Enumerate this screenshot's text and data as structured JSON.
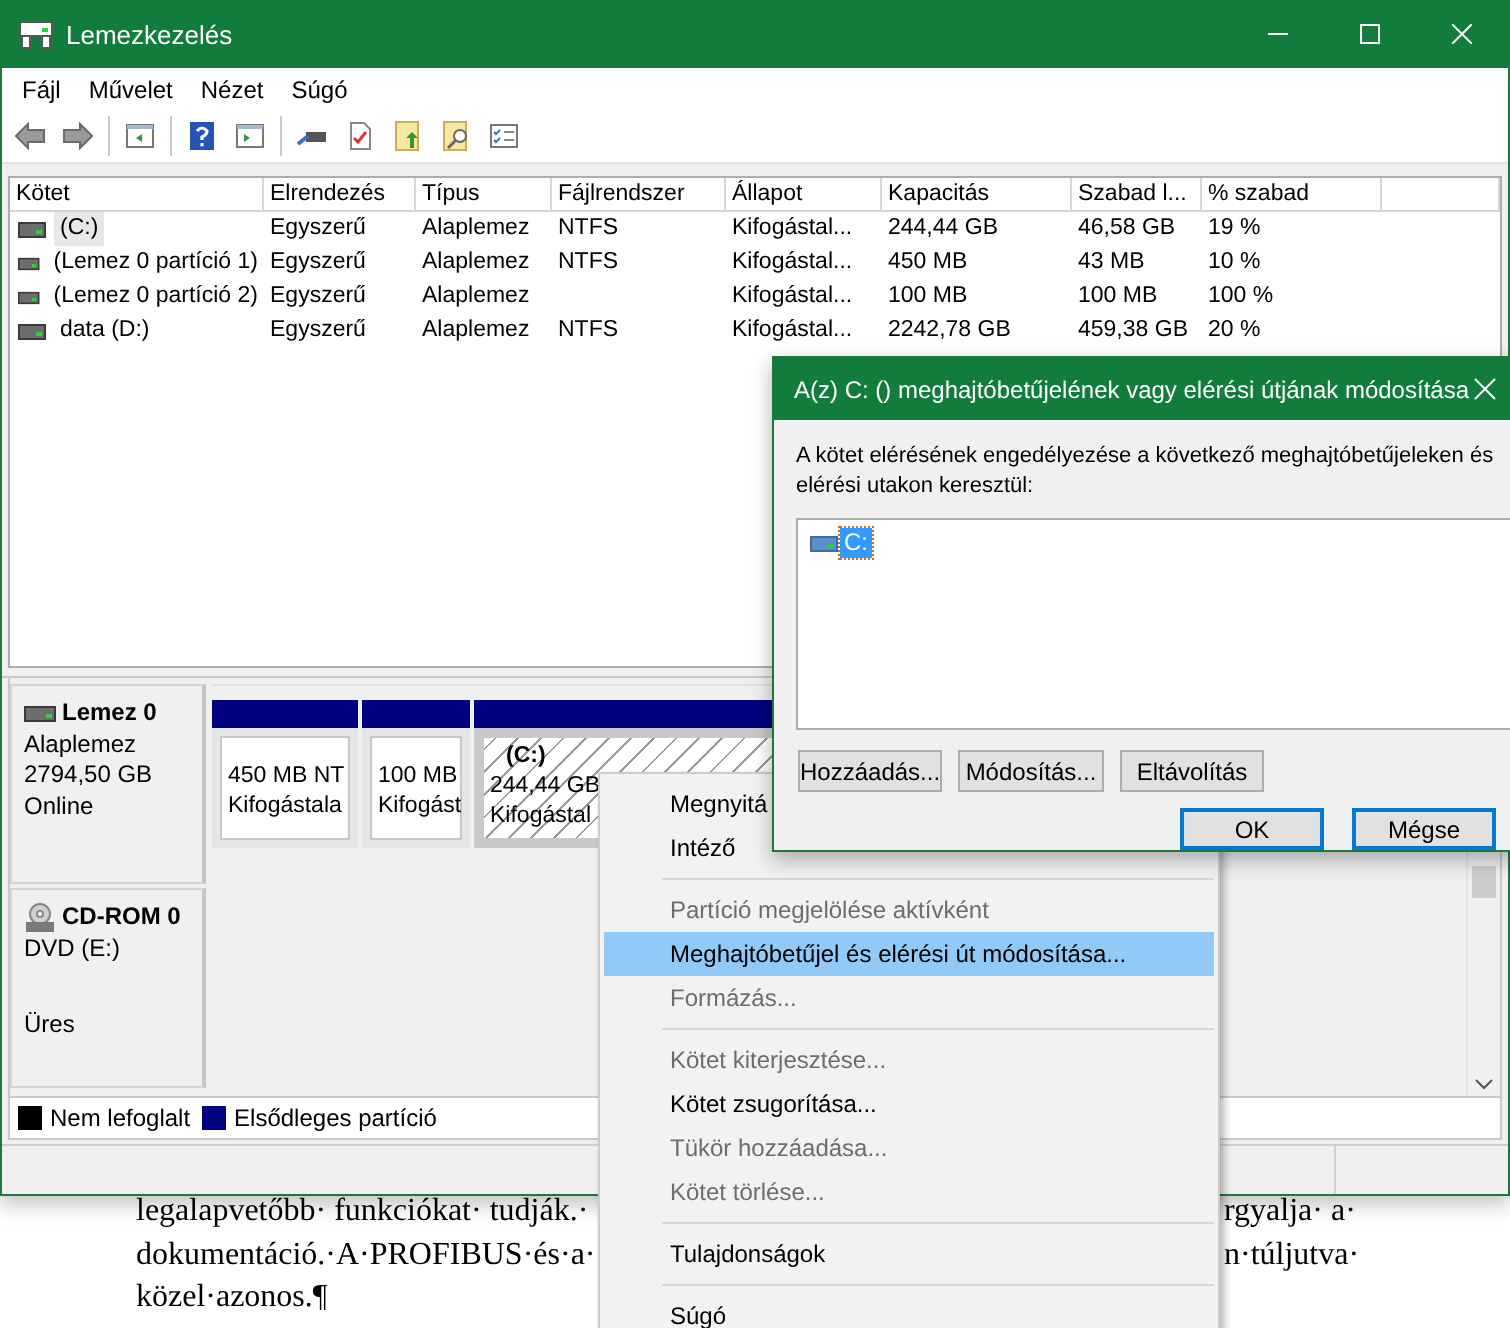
{
  "window": {
    "title": "Lemezkezelés"
  },
  "menu_bar": [
    "Fájl",
    "Művelet",
    "Nézet",
    "Súgó"
  ],
  "volume_table": {
    "columns": [
      "Kötet",
      "Elrendezés",
      "Típus",
      "Fájlrendszer",
      "Állapot",
      "Kapacitás",
      "Szabad l...",
      "% szabad"
    ],
    "rows": [
      {
        "selected": true,
        "cells": [
          "(C:)",
          "Egyszerű",
          "Alaplemez",
          "NTFS",
          "Kifogástal...",
          "244,44 GB",
          "46,58 GB",
          "19 %"
        ]
      },
      {
        "selected": false,
        "cells": [
          "(Lemez 0 partíció 1)",
          "Egyszerű",
          "Alaplemez",
          "NTFS",
          "Kifogástal...",
          "450 MB",
          "43 MB",
          "10 %"
        ]
      },
      {
        "selected": false,
        "cells": [
          "(Lemez 0 partíció 2)",
          "Egyszerű",
          "Alaplemez",
          null,
          "Kifogástal...",
          "100 MB",
          "100 MB",
          "100 %"
        ]
      },
      {
        "selected": false,
        "cells": [
          "data (D:)",
          "Egyszerű",
          "Alaplemez",
          "NTFS",
          "Kifogástal...",
          "2242,78 GB",
          "459,38 GB",
          "20 %"
        ]
      }
    ]
  },
  "disks": [
    {
      "kind": "disk",
      "name": "Lemez 0",
      "type": "Alaplemez",
      "size": "2794,50 GB",
      "status": "Online",
      "partitions": [
        {
          "size": "450 MB NT",
          "status": "Kifogástala",
          "selected": false
        },
        {
          "size": "100 MB",
          "status": "Kifogást",
          "selected": false
        },
        {
          "name": "(C:)",
          "size": "244,44 GB",
          "status": "Kifogástal",
          "selected": true
        }
      ]
    },
    {
      "kind": "cdrom",
      "name": "CD-ROM 0",
      "type": "DVD (E:)",
      "status": "Üres"
    }
  ],
  "legend": [
    {
      "label": "Nem lefoglalt",
      "color": "#000000"
    },
    {
      "label": "Elsődleges partíció",
      "color": "#000080"
    }
  ],
  "context_menu": {
    "items": [
      {
        "kind": "item",
        "label": "Megnyitá",
        "disabled": false,
        "selected": false
      },
      {
        "kind": "item",
        "label": "Intéző",
        "disabled": false,
        "selected": false
      },
      {
        "kind": "separator"
      },
      {
        "kind": "item",
        "label": "Partíció megjelölése aktívként",
        "disabled": true,
        "selected": false
      },
      {
        "kind": "item",
        "label": "Meghajtóbetűjel és elérési út módosítása...",
        "disabled": false,
        "selected": true
      },
      {
        "kind": "item",
        "label": "Formázás...",
        "disabled": true,
        "selected": false
      },
      {
        "kind": "separator"
      },
      {
        "kind": "item",
        "label": "Kötet kiterjesztése...",
        "disabled": true,
        "selected": false
      },
      {
        "kind": "item",
        "label": "Kötet zsugorítása...",
        "disabled": false,
        "selected": false
      },
      {
        "kind": "item",
        "label": "Tükör hozzáadása...",
        "disabled": true,
        "selected": false
      },
      {
        "kind": "item",
        "label": "Kötet törlése...",
        "disabled": true,
        "selected": false
      },
      {
        "kind": "separator"
      },
      {
        "kind": "item",
        "label": "Tulajdonságok",
        "disabled": false,
        "selected": false
      },
      {
        "kind": "separator"
      },
      {
        "kind": "item",
        "label": "Súgó",
        "disabled": false,
        "selected": false
      }
    ]
  },
  "dialog": {
    "title": "A(z) C: () meghajtóbetűjelének vagy elérési útjának módosítása",
    "description": "A kötet elérésének engedélyezése a következő meghajtóbetűjeleken és elérési utakon keresztül:",
    "paths": [
      {
        "label": "C:",
        "selected": true
      }
    ],
    "list_buttons": [
      "Hozzáadás...",
      "Módosítás...",
      "Eltávolítás"
    ],
    "footer_buttons": [
      "OK",
      "Mégse"
    ]
  },
  "document": {
    "lines": [
      {
        "left": "legalapvetőbb· funkciókat· tudják.·",
        "right": "rgyalja· a·"
      },
      {
        "left": "dokumentáció.·A·PROFIBUS·és·a·",
        "right": "n·túljutva·"
      },
      {
        "left": "közel·azonos.¶"
      }
    ]
  }
}
